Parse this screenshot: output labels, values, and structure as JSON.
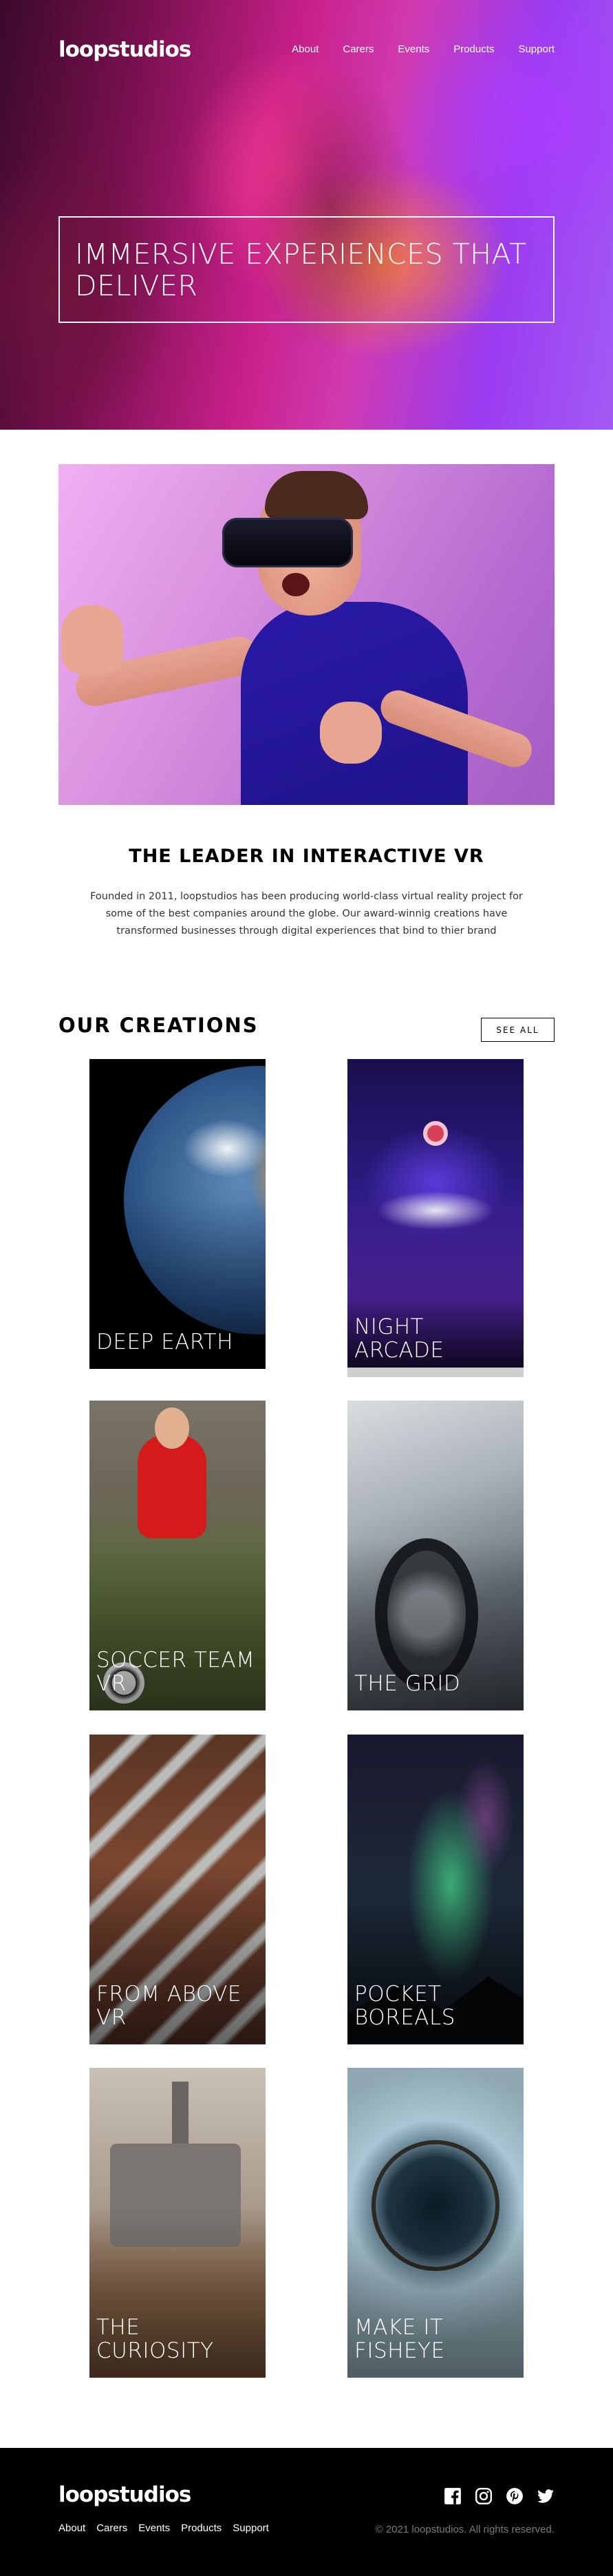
{
  "brand": "loopstudios",
  "nav": {
    "links": [
      "About",
      "Carers",
      "Events",
      "Products",
      "Support"
    ]
  },
  "hero": {
    "title": "Immersive experiences that deliver"
  },
  "interactive": {
    "image_alt": "man wearing VR headset",
    "title": "The leader in interactive VR",
    "text": "Founded in 2011, loopstudios has been producing world-class virtual reality project for some of the best companies around the globe. Our award-winnig creations have transformed businesses through digital experiences that bind to thier brand"
  },
  "creations": {
    "title": "Our creations",
    "see_all": "See all",
    "items": [
      {
        "label": "Deep Earth"
      },
      {
        "label": "Night Arcade"
      },
      {
        "label": "Soccer Team VR"
      },
      {
        "label": "The Grid"
      },
      {
        "label": "From Above VR"
      },
      {
        "label": "Pocket Boreals"
      },
      {
        "label": "The Curiosity"
      },
      {
        "label": "Make it Fisheye"
      }
    ]
  },
  "footer": {
    "brand": "loopstudios",
    "links": [
      "About",
      "Carers",
      "Events",
      "Products",
      "Support"
    ],
    "socials": [
      "facebook-icon",
      "instagram-icon",
      "pinterest-icon",
      "twitter-icon"
    ],
    "copyright": "© 2021 loopstudios. All rights reserved."
  },
  "colors": {
    "footer_bg": "#000000",
    "text_muted": "#7a7a7a",
    "hero_accent": "#c8208a"
  }
}
